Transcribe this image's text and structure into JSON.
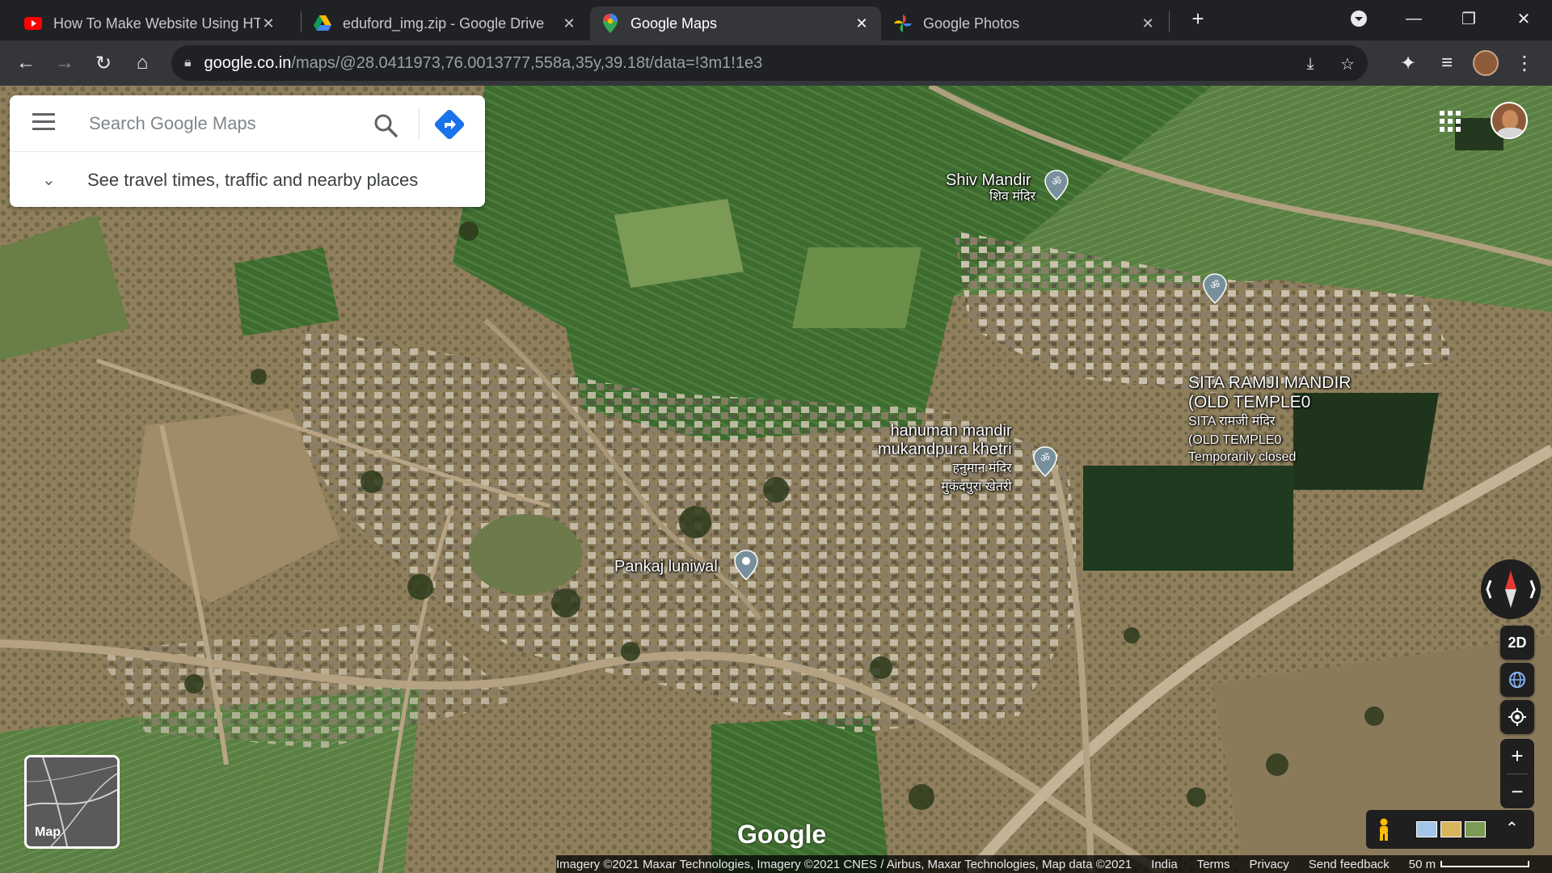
{
  "tabs": [
    {
      "title": "How To Make Website Using HTM",
      "icon": "youtube-icon",
      "active": false
    },
    {
      "title": "eduford_img.zip - Google Drive",
      "icon": "google-drive-icon",
      "active": false
    },
    {
      "title": "Google Maps",
      "icon": "google-maps-icon",
      "active": true
    },
    {
      "title": "Google Photos",
      "icon": "google-photos-icon",
      "active": false
    }
  ],
  "address_bar": {
    "host": "google.co.in",
    "path": "/maps/@28.0411973,76.0013777,558a,35y,39.18t/data=!3m1!1e3"
  },
  "search": {
    "placeholder": "Search Google Maps",
    "nearby": "See travel times, traffic and nearby places"
  },
  "places": [
    {
      "name": "Shiv Mandir",
      "local": "शिव मंदिर",
      "icon": "hindu-temple-icon"
    },
    {
      "name": "SITA RAMJI MANDIR\n(OLD TEMPLE0",
      "local": "SITA रामजी मंदिर\n(OLD TEMPLE0",
      "status": "Temporarily closed",
      "icon": "hindu-temple-icon"
    },
    {
      "name": "hanuman mandir\nmukandpura khetri",
      "local": "हनुमान मंदिर\nमुकंदपुरा खेतरी",
      "icon": "hindu-temple-icon"
    },
    {
      "name": "Pankaj luniwal",
      "icon": "location-pin-icon"
    }
  ],
  "controls": {
    "view_mode": "2D",
    "zoom_in": "+",
    "zoom_out": "−",
    "minimap_label": "Map",
    "logo": "Google"
  },
  "attribution": {
    "imagery": "Imagery ©2021 Maxar Technologies, Imagery ©2021 CNES / Airbus, Maxar Technologies, Map data ©2021",
    "country": "India",
    "terms": "Terms",
    "privacy": "Privacy",
    "feedback": "Send feedback",
    "scale": "50 m"
  },
  "colors": {
    "accent": "#1a73e8",
    "tab_bg": "#202124",
    "toolbar_bg": "#35363a"
  }
}
